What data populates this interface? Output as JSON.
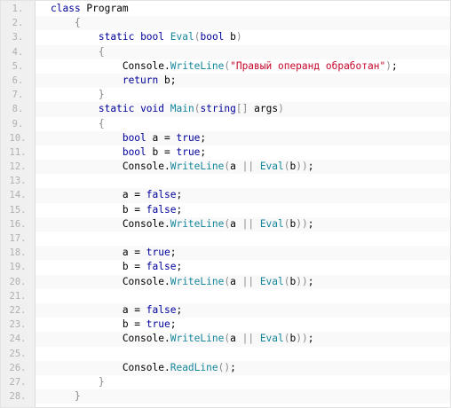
{
  "lines": [
    {
      "n": "1.",
      "tokens": [
        [
          "kw",
          "class"
        ],
        [
          "t",
          " Program"
        ]
      ]
    },
    {
      "n": "2.",
      "tokens": [
        [
          "t",
          "    "
        ],
        [
          "p",
          "{"
        ]
      ]
    },
    {
      "n": "3.",
      "tokens": [
        [
          "t",
          "        "
        ],
        [
          "kw",
          "static"
        ],
        [
          "t",
          " "
        ],
        [
          "kw",
          "bool"
        ],
        [
          "t",
          " "
        ],
        [
          "fn",
          "Eval"
        ],
        [
          "p",
          "("
        ],
        [
          "kw",
          "bool"
        ],
        [
          "t",
          " b"
        ],
        [
          "p",
          ")"
        ]
      ]
    },
    {
      "n": "4.",
      "tokens": [
        [
          "t",
          "        "
        ],
        [
          "p",
          "{"
        ]
      ]
    },
    {
      "n": "5.",
      "tokens": [
        [
          "t",
          "            Console."
        ],
        [
          "fn",
          "WriteLine"
        ],
        [
          "p",
          "("
        ],
        [
          "str",
          "\"Правый операнд обработан\""
        ],
        [
          "p",
          ")"
        ],
        [
          "t",
          ";"
        ]
      ]
    },
    {
      "n": "6.",
      "tokens": [
        [
          "t",
          "            "
        ],
        [
          "kw",
          "return"
        ],
        [
          "t",
          " b;"
        ]
      ]
    },
    {
      "n": "7.",
      "tokens": [
        [
          "t",
          "        "
        ],
        [
          "p",
          "}"
        ]
      ]
    },
    {
      "n": "8.",
      "tokens": [
        [
          "t",
          "        "
        ],
        [
          "kw",
          "static"
        ],
        [
          "t",
          " "
        ],
        [
          "kw",
          "void"
        ],
        [
          "t",
          " "
        ],
        [
          "fn",
          "Main"
        ],
        [
          "p",
          "("
        ],
        [
          "kw",
          "string"
        ],
        [
          "p",
          "[]"
        ],
        [
          "t",
          " args"
        ],
        [
          "p",
          ")"
        ]
      ]
    },
    {
      "n": "9.",
      "tokens": [
        [
          "t",
          "        "
        ],
        [
          "p",
          "{"
        ]
      ]
    },
    {
      "n": "10.",
      "tokens": [
        [
          "t",
          "            "
        ],
        [
          "kw",
          "bool"
        ],
        [
          "t",
          " a = "
        ],
        [
          "kw",
          "true"
        ],
        [
          "t",
          ";"
        ]
      ]
    },
    {
      "n": "11.",
      "tokens": [
        [
          "t",
          "            "
        ],
        [
          "kw",
          "bool"
        ],
        [
          "t",
          " b = "
        ],
        [
          "kw",
          "true"
        ],
        [
          "t",
          ";"
        ]
      ]
    },
    {
      "n": "12.",
      "tokens": [
        [
          "t",
          "            Console."
        ],
        [
          "fn",
          "WriteLine"
        ],
        [
          "p",
          "("
        ],
        [
          "t",
          "a "
        ],
        [
          "p",
          "||"
        ],
        [
          "t",
          " "
        ],
        [
          "fn",
          "Eval"
        ],
        [
          "p",
          "("
        ],
        [
          "t",
          "b"
        ],
        [
          "p",
          "))"
        ],
        [
          "t",
          ";"
        ]
      ]
    },
    {
      "n": "13.",
      "tokens": []
    },
    {
      "n": "14.",
      "tokens": [
        [
          "t",
          "            a = "
        ],
        [
          "kw",
          "false"
        ],
        [
          "t",
          ";"
        ]
      ]
    },
    {
      "n": "15.",
      "tokens": [
        [
          "t",
          "            b = "
        ],
        [
          "kw",
          "false"
        ],
        [
          "t",
          ";"
        ]
      ]
    },
    {
      "n": "16.",
      "tokens": [
        [
          "t",
          "            Console."
        ],
        [
          "fn",
          "WriteLine"
        ],
        [
          "p",
          "("
        ],
        [
          "t",
          "a "
        ],
        [
          "p",
          "||"
        ],
        [
          "t",
          " "
        ],
        [
          "fn",
          "Eval"
        ],
        [
          "p",
          "("
        ],
        [
          "t",
          "b"
        ],
        [
          "p",
          "))"
        ],
        [
          "t",
          ";"
        ]
      ]
    },
    {
      "n": "17.",
      "tokens": []
    },
    {
      "n": "18.",
      "tokens": [
        [
          "t",
          "            a = "
        ],
        [
          "kw",
          "true"
        ],
        [
          "t",
          ";"
        ]
      ]
    },
    {
      "n": "19.",
      "tokens": [
        [
          "t",
          "            b = "
        ],
        [
          "kw",
          "false"
        ],
        [
          "t",
          ";"
        ]
      ]
    },
    {
      "n": "20.",
      "tokens": [
        [
          "t",
          "            Console."
        ],
        [
          "fn",
          "WriteLine"
        ],
        [
          "p",
          "("
        ],
        [
          "t",
          "a "
        ],
        [
          "p",
          "||"
        ],
        [
          "t",
          " "
        ],
        [
          "fn",
          "Eval"
        ],
        [
          "p",
          "("
        ],
        [
          "t",
          "b"
        ],
        [
          "p",
          "))"
        ],
        [
          "t",
          ";"
        ]
      ]
    },
    {
      "n": "21.",
      "tokens": []
    },
    {
      "n": "22.",
      "tokens": [
        [
          "t",
          "            a = "
        ],
        [
          "kw",
          "false"
        ],
        [
          "t",
          ";"
        ]
      ]
    },
    {
      "n": "23.",
      "tokens": [
        [
          "t",
          "            b = "
        ],
        [
          "kw",
          "true"
        ],
        [
          "t",
          ";"
        ]
      ]
    },
    {
      "n": "24.",
      "tokens": [
        [
          "t",
          "            Console."
        ],
        [
          "fn",
          "WriteLine"
        ],
        [
          "p",
          "("
        ],
        [
          "t",
          "a "
        ],
        [
          "p",
          "||"
        ],
        [
          "t",
          " "
        ],
        [
          "fn",
          "Eval"
        ],
        [
          "p",
          "("
        ],
        [
          "t",
          "b"
        ],
        [
          "p",
          "))"
        ],
        [
          "t",
          ";"
        ]
      ]
    },
    {
      "n": "25.",
      "tokens": []
    },
    {
      "n": "26.",
      "tokens": [
        [
          "t",
          "            Console."
        ],
        [
          "fn",
          "ReadLine"
        ],
        [
          "p",
          "()"
        ],
        [
          "t",
          ";"
        ]
      ]
    },
    {
      "n": "27.",
      "tokens": [
        [
          "t",
          "        "
        ],
        [
          "p",
          "}"
        ]
      ]
    },
    {
      "n": "28.",
      "tokens": [
        [
          "t",
          "    "
        ],
        [
          "p",
          "}"
        ]
      ]
    }
  ],
  "colors": {
    "keyword": "#00009a",
    "method": "#15869a",
    "string": "#c6062a",
    "punctuation": "#8a8a8a",
    "line_number": "#afafaf",
    "gutter_bg": "#f0f0f0"
  }
}
